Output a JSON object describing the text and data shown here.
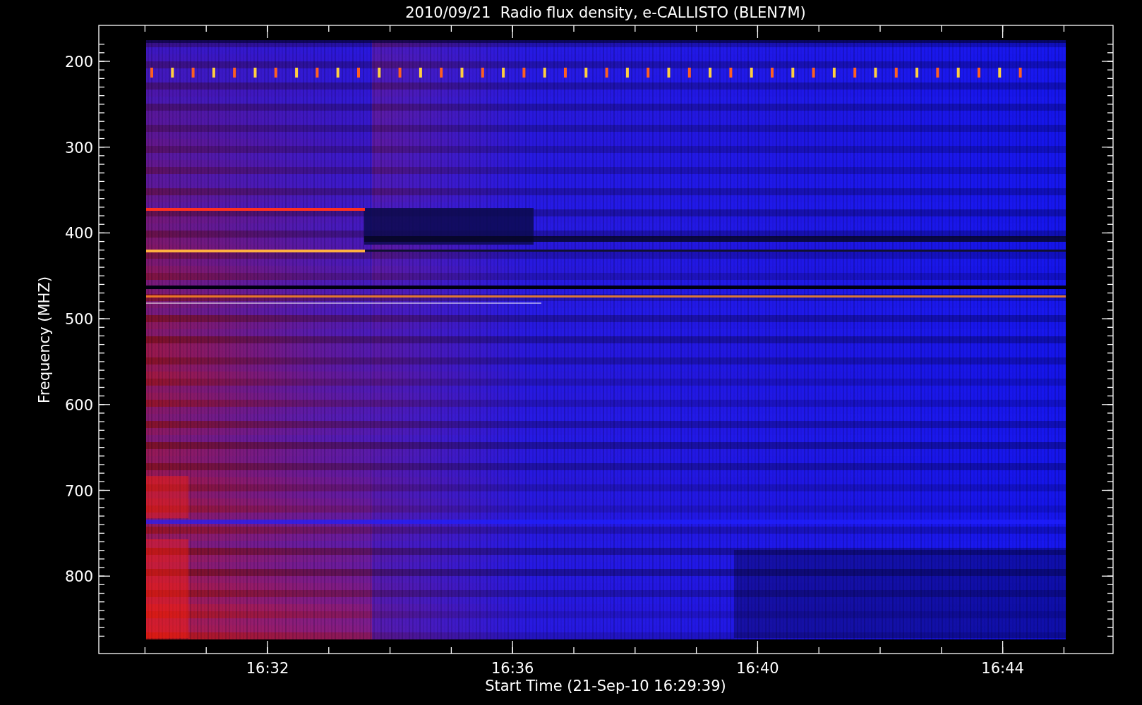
{
  "chart": {
    "title": "2010/09/21  Radio flux density, e-CALLISTO (BLEN7M)",
    "xlabel": "Start Time (21-Sep-10 16:29:39)",
    "ylabel": "Frequency (MHZ)",
    "xticks": [
      "16:32",
      "16:36",
      "16:40",
      "16:44"
    ],
    "yticks": [
      "200",
      "300",
      "400",
      "500",
      "600",
      "700",
      "800"
    ]
  }
}
